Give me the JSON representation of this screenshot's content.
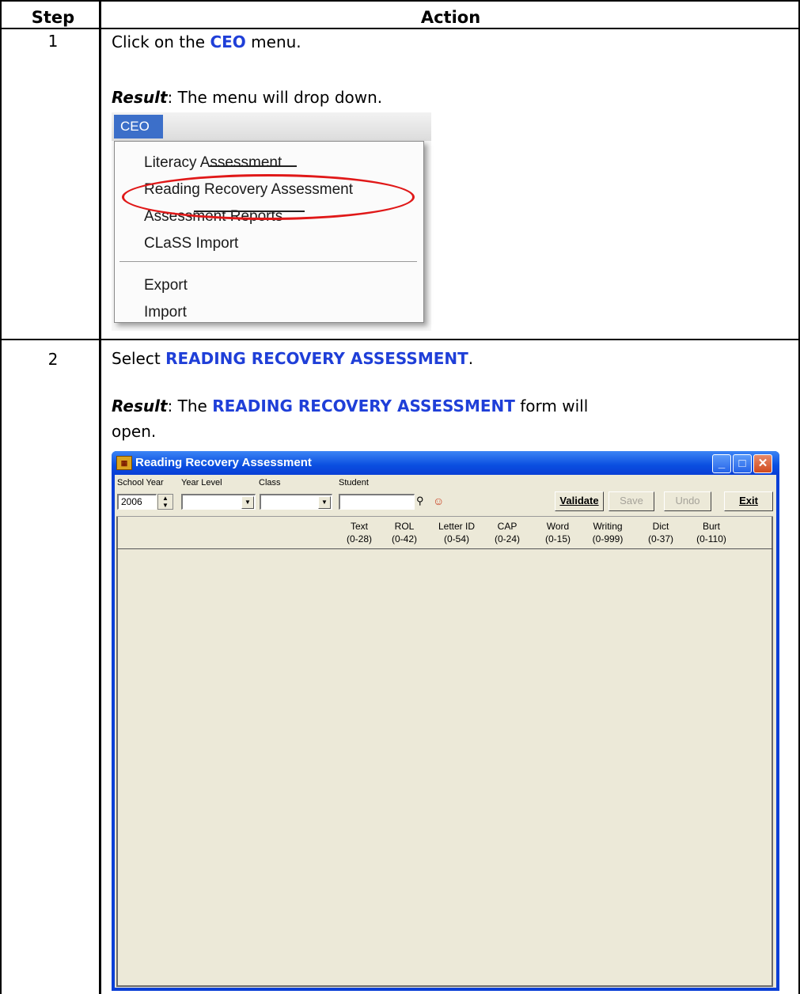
{
  "table": {
    "header_step": "Step",
    "header_action": "Action"
  },
  "step1": {
    "number": "1",
    "instruction_prefix": "Click on the ",
    "instruction_keyword": "CEO",
    "instruction_suffix": " menu.",
    "result_label": "Result",
    "result_text": ": The menu will drop down."
  },
  "ceo_menu": {
    "menu_title": "CEO",
    "items": [
      "Literacy Assessment",
      "Reading Recovery Assessment",
      "Assessment Reports",
      "CLaSS Import",
      "Export",
      "Import"
    ],
    "highlight_color": "#e01818"
  },
  "step2": {
    "number": "2",
    "instruction_prefix": "Select ",
    "instruction_keyword": "READING RECOVERY ASSESSMENT",
    "instruction_suffix": ".",
    "result_label": "Result",
    "result_text_a": ": The ",
    "result_keyword": "READING RECOVERY ASSESSMENT",
    "result_text_b": " form will",
    "result_text_c": "open."
  },
  "rr_window": {
    "title": "Reading Recovery Assessment",
    "labels": {
      "school_year": "School Year",
      "year_level": "Year Level",
      "class": "Class",
      "student": "Student"
    },
    "school_year_value": "2006",
    "buttons": {
      "validate": "Validate",
      "save": "Save",
      "undo": "Undo",
      "exit": "Exit"
    },
    "columns": [
      {
        "name": "Text",
        "range": "(0-28)"
      },
      {
        "name": "ROL",
        "range": "(0-42)"
      },
      {
        "name": "Letter ID",
        "range": "(0-54)"
      },
      {
        "name": "CAP",
        "range": "(0-24)"
      },
      {
        "name": "Word",
        "range": "(0-15)"
      },
      {
        "name": "Writing",
        "range": "(0-999)"
      },
      {
        "name": "Dict",
        "range": "(0-37)"
      },
      {
        "name": "Burt",
        "range": "(0-110)"
      }
    ]
  },
  "colors": {
    "keyword": "#1f3fd8",
    "titlebar": "#0a4ee0",
    "window_face": "#ece9d8"
  }
}
